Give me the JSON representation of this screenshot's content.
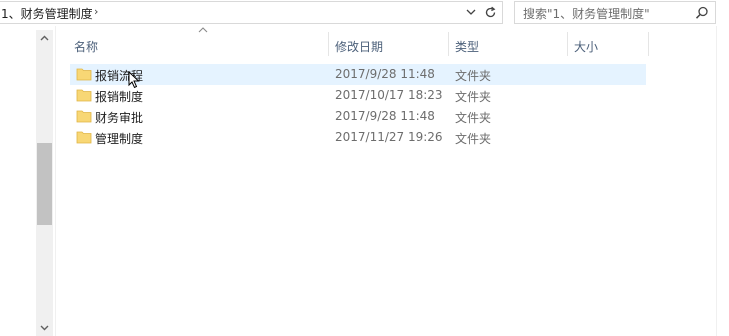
{
  "address_bar": {
    "breadcrumb": "1、财务管理制度",
    "separator": "›"
  },
  "search": {
    "placeholder": "搜索\"1、财务管理制度\""
  },
  "columns": {
    "name": "名称",
    "modified": "修改日期",
    "type": "类型",
    "size": "大小"
  },
  "files": [
    {
      "name": "报销流程",
      "modified": "2017/9/28 11:48",
      "type": "文件夹",
      "selected": true
    },
    {
      "name": "报销制度",
      "modified": "2017/10/17 18:23",
      "type": "文件夹",
      "selected": false
    },
    {
      "name": "财务审批",
      "modified": "2017/9/28 11:48",
      "type": "文件夹",
      "selected": false
    },
    {
      "name": "管理制度",
      "modified": "2017/11/27 19:26",
      "type": "文件夹",
      "selected": false
    }
  ],
  "colors": {
    "selection": "#e5f3ff",
    "header_text": "#4c607a",
    "folder": "#f8d775"
  },
  "icons": [
    "chevron-down-icon",
    "refresh-icon",
    "search-icon",
    "folder-icon",
    "sort-up-icon",
    "mouse-cursor-icon"
  ]
}
